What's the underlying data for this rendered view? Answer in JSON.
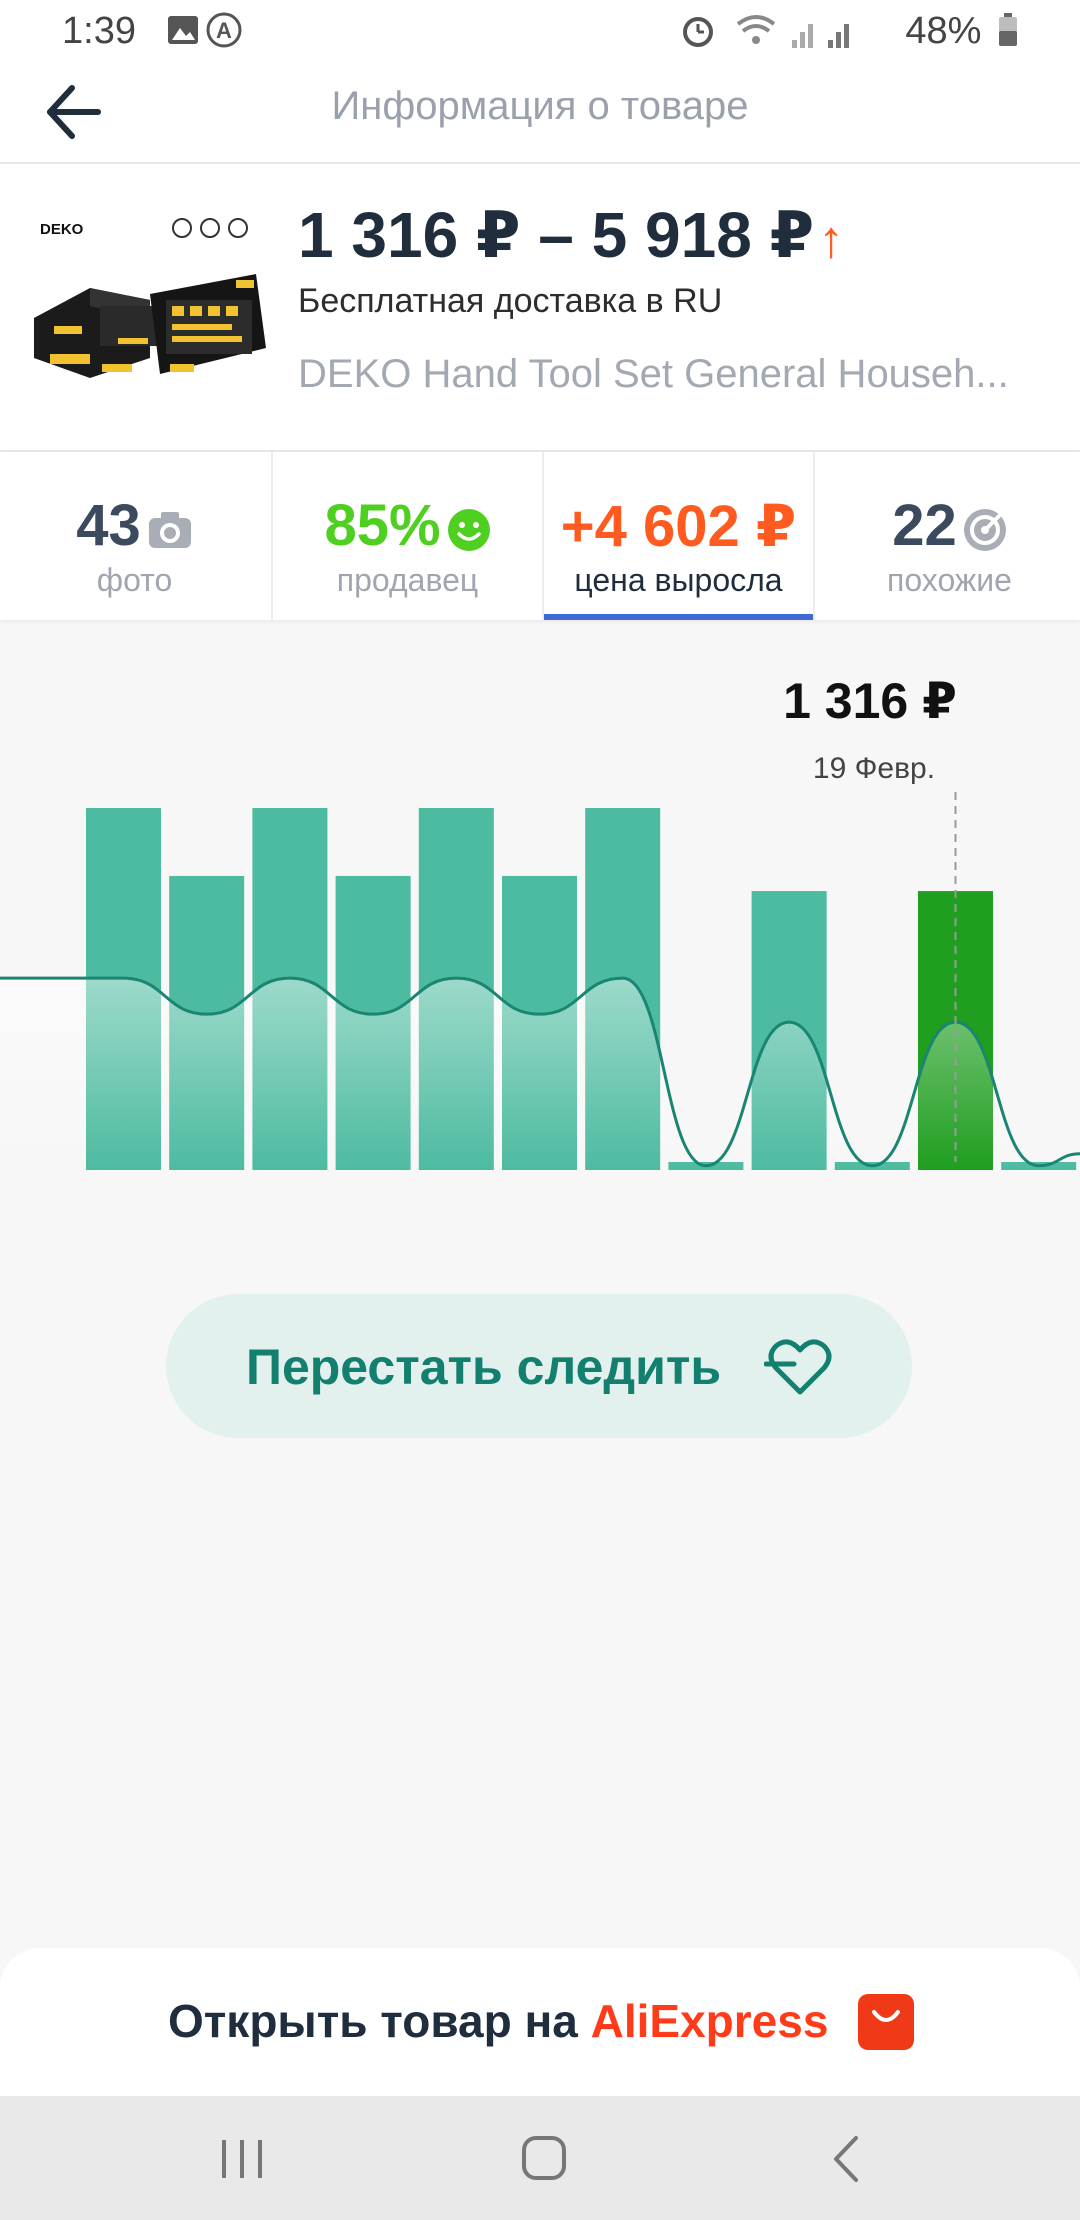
{
  "status_bar": {
    "time": "1:39",
    "battery": "48%"
  },
  "header": {
    "title": "Информация о товаре"
  },
  "product": {
    "price_range": "1 316 ₽ – 5 918 ₽",
    "delivery": "Бесплатная доставка в RU",
    "name": "DEKO Hand Tool Set General Househ...",
    "image_brand": "DEKO"
  },
  "stats": {
    "photos": {
      "value": "43",
      "label": "фото"
    },
    "seller": {
      "value": "85%",
      "label": "продавец"
    },
    "price_change": {
      "value": "+4 602 ₽",
      "label": "цена выросла"
    },
    "similar": {
      "value": "22",
      "label": "похожие"
    }
  },
  "chart_data": {
    "type": "bar",
    "categories": [
      "",
      "",
      "",
      "",
      "",
      "",
      "",
      "",
      "",
      "",
      "",
      ""
    ],
    "values": [
      5918,
      5054,
      5918,
      5054,
      5918,
      5054,
      5918,
      1316,
      4862,
      1316,
      4862,
      1316
    ],
    "ylim": [
      1316,
      5918
    ],
    "highlight_index": 10,
    "tooltip": {
      "price": "1 316 ₽",
      "date": "19 Февр."
    },
    "colors": {
      "bar": "#4dbba0",
      "highlight": "#1f9e1f",
      "line": "#1a8573"
    }
  },
  "actions": {
    "unfollow": "Перестать следить",
    "open_prefix": "Открыть товар на",
    "open_brand": "AliExpress"
  },
  "colors": {
    "accent_red": "#ff5a1f",
    "seller_green": "#4fcf1f",
    "tab_underline": "#3e6ad6",
    "button_bg": "#e3f1ee",
    "button_text": "#137f6f"
  }
}
